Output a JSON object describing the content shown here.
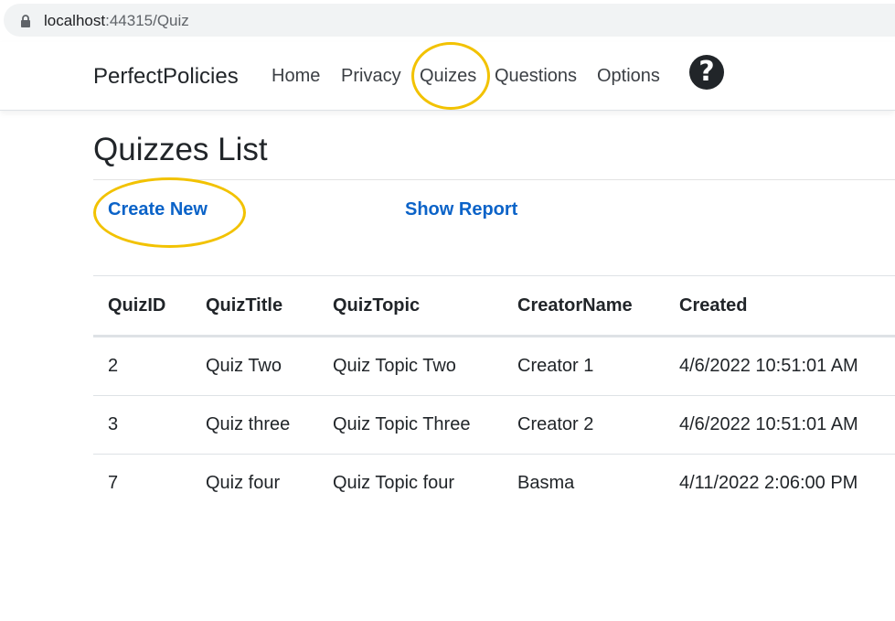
{
  "browser": {
    "url_host": "localhost",
    "url_path": ":44315/Quiz"
  },
  "navbar": {
    "brand": "PerfectPolicies",
    "links": [
      "Home",
      "Privacy",
      "Quizes",
      "Questions",
      "Options"
    ],
    "help_glyph": "?"
  },
  "page": {
    "title": "Quizzes List",
    "create_new": "Create New",
    "show_report": "Show Report"
  },
  "table": {
    "headers": [
      "QuizID",
      "QuizTitle",
      "QuizTopic",
      "CreatorName",
      "Created"
    ],
    "rows": [
      [
        "2",
        "Quiz Two",
        "Quiz Topic Two",
        "Creator 1",
        "4/6/2022 10:51:01 AM"
      ],
      [
        "3",
        "Quiz three",
        "Quiz Topic Three",
        "Creator 2",
        "4/6/2022 10:51:01 AM"
      ],
      [
        "7",
        "Quiz four",
        "Quiz Topic four",
        "Basma",
        "4/11/2022 2:06:00 PM"
      ]
    ]
  },
  "annotation_color": "#f2c200",
  "link_color": "#0b63c8"
}
